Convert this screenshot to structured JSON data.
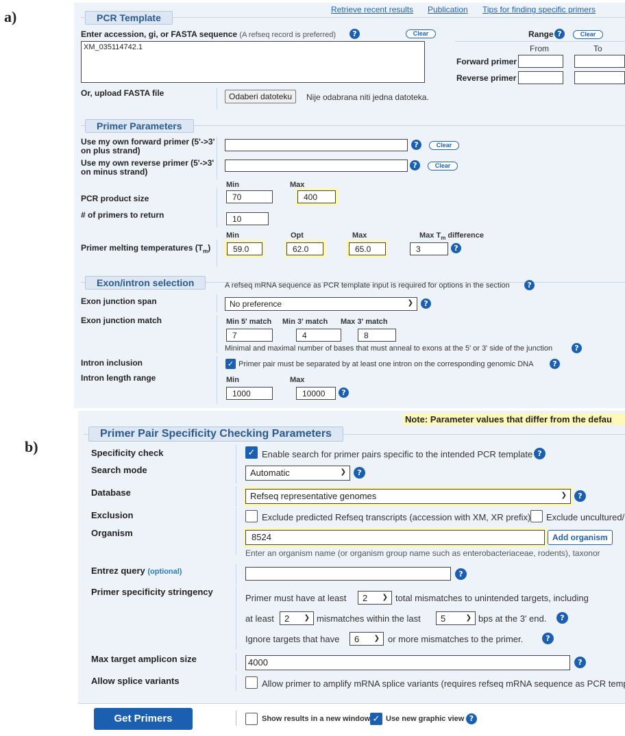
{
  "labels": {
    "a": "a)",
    "b": "b)"
  },
  "links": {
    "retrieve": "Retrieve recent results",
    "publication": "Publication",
    "tips": "Tips for finding specific primers"
  },
  "pcr_template": {
    "legend": "PCR Template",
    "enter_label": "Enter accession, gi, or FASTA sequence",
    "enter_note": "(A refseq record is preferred)",
    "clear": "Clear",
    "sequence_value": "XM_035114742.1",
    "range_label": "Range",
    "from": "From",
    "to": "To",
    "forward_primer": "Forward primer",
    "reverse_primer": "Reverse primer",
    "upload_label": "Or, upload FASTA file",
    "file_button": "Odaberi datoteku",
    "file_status": "Nije odabrana niti jedna datoteka."
  },
  "primer_params": {
    "legend": "Primer Parameters",
    "own_forward": "Use my own forward primer (5'->3' on plus strand)",
    "own_reverse": "Use my own reverse primer (5'->3' on minus strand)",
    "clear": "Clear",
    "min": "Min",
    "max": "Max",
    "opt": "Opt",
    "product_size": "PCR product size",
    "product_min": "70",
    "product_max": "400",
    "num_primers": "# of primers to return",
    "num_primers_value": "10",
    "melting": "Primer melting temperatures (T",
    "melting_sub": "m",
    "melting_end": ")",
    "tm_min": "59.0",
    "tm_opt": "62.0",
    "tm_max": "65.0",
    "max_tm_diff": "Max T",
    "max_tm_diff_sub": "m",
    "max_tm_diff_end": " difference",
    "tm_diff": "3"
  },
  "exon": {
    "legend": "Exon/intron selection",
    "note": "A refseq mRNA sequence as PCR template input is required for options in the section",
    "span_label": "Exon junction span",
    "span_value": "No preference",
    "match_label": "Exon junction match",
    "min5": "Min 5' match",
    "min3": "Min 3' match",
    "max3": "Max 3' match",
    "min5_val": "7",
    "min3_val": "4",
    "max3_val": "8",
    "match_note": "Minimal and maximal number of bases that must anneal to exons at the 5' or 3' side of the junction",
    "intron_label": "Intron inclusion",
    "intron_text": "Primer pair must be separated by at least one intron on the corresponding genomic DNA",
    "length_label": "Intron length range",
    "min": "Min",
    "max": "Max",
    "len_min": "1000",
    "len_max": "10000"
  },
  "specificity": {
    "note": "Note: Parameter values that differ from the defau",
    "legend": "Primer Pair Specificity Checking Parameters",
    "check_label": "Specificity check",
    "check_text": "Enable search for primer pairs specific to the intended PCR template",
    "mode_label": "Search mode",
    "mode_value": "Automatic",
    "db_label": "Database",
    "db_value": "Refseq representative genomes",
    "excl_label": "Exclusion",
    "excl_text1": "Exclude predicted Refseq transcripts (accession with XM, XR prefix)",
    "excl_text2": "Exclude uncultured/",
    "org_label": "Organism",
    "org_value": "8524",
    "add_org": "Add organism",
    "org_hint": "Enter an organism name (or organism group name such as enterobacteriaceae, rodents), taxonor",
    "entrez_label": "Entrez query",
    "entrez_opt": "(optional)",
    "stringency_label": "Primer specificity stringency",
    "s1a": "Primer must have at least",
    "s1_val": "2",
    "s1b": "total mismatches to unintended targets, including",
    "s2a": "at least",
    "s2_val": "2",
    "s2b": "mismatches within the last",
    "s2_val2": "5",
    "s2c": "bps at the 3' end.",
    "s3a": "Ignore targets that have",
    "s3_val": "6",
    "s3b": "or more mismatches to the primer.",
    "amplicon_label": "Max target amplicon size",
    "amplicon_value": "4000",
    "splice_label": "Allow splice variants",
    "splice_text": "Allow primer to amplify mRNA splice variants (requires refseq mRNA sequence as PCR temp"
  },
  "submit": {
    "button": "Get Primers",
    "new_window": "Show results in a new window",
    "graphic": "Use new graphic view"
  }
}
